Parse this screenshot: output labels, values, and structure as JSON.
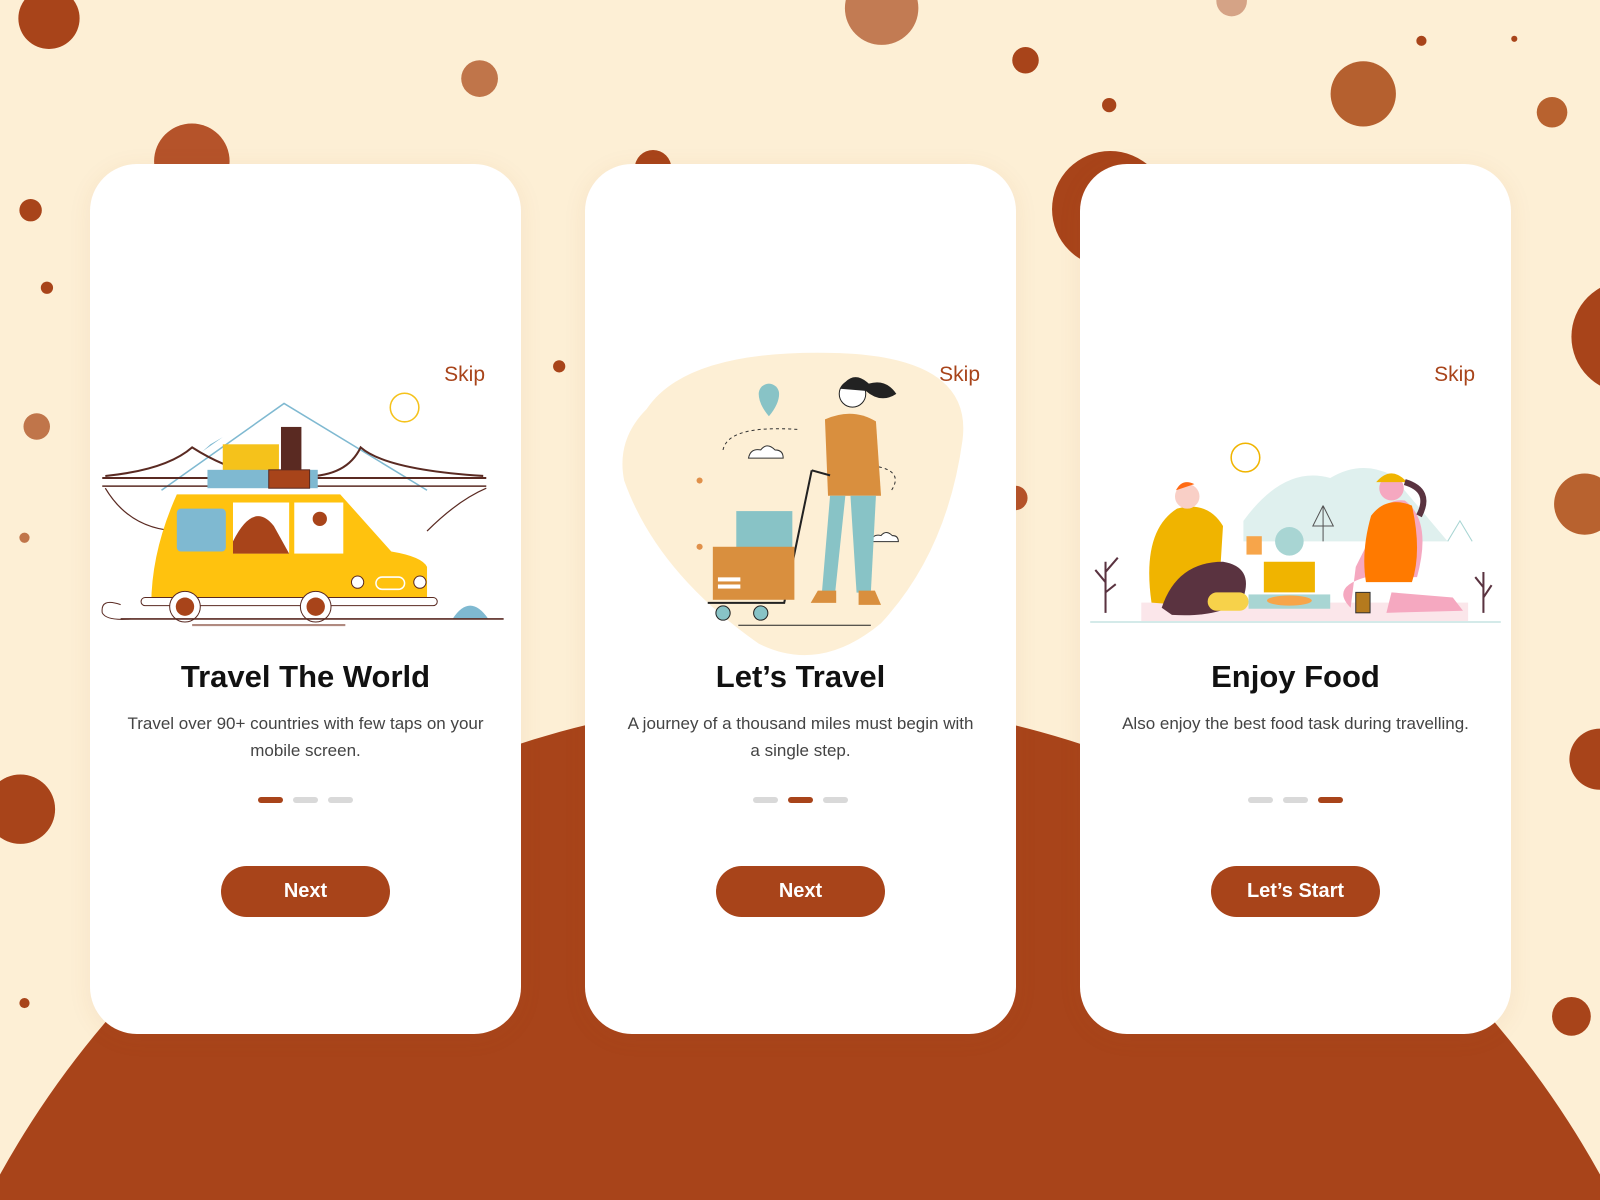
{
  "colors": {
    "accent": "#a8441a",
    "background": "#fdefd5",
    "card": "#ffffff",
    "dot_inactive": "#d9d9d9"
  },
  "screens": [
    {
      "skip": "Skip",
      "title": "Travel The World",
      "description": "Travel over 90+ countries with few taps on your mobile screen.",
      "active_page": 1,
      "page_count": 3,
      "button": "Next",
      "illustration": "car-road-trip-illustration"
    },
    {
      "skip": "Skip",
      "title": "Let’s Travel",
      "description": "A journey of a thousand miles must begin with a single step.",
      "active_page": 2,
      "page_count": 3,
      "button": "Next",
      "illustration": "woman-with-luggage-trolley-illustration"
    },
    {
      "skip": "Skip",
      "title": "Enjoy Food",
      "description": "Also enjoy the best food task during travelling.",
      "active_page": 3,
      "page_count": 3,
      "button": "Let’s Start",
      "illustration": "picnic-illustration"
    }
  ]
}
